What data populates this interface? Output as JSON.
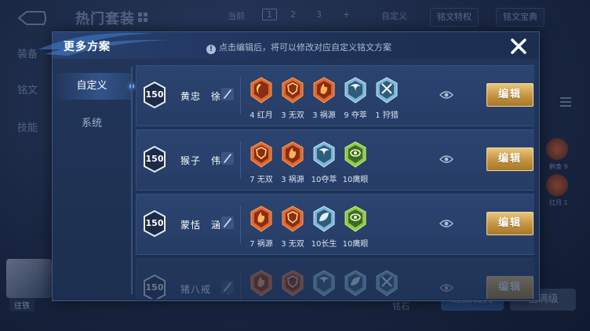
{
  "background": {
    "title": "热门套装",
    "pager": {
      "label": "当前",
      "pages": [
        "1",
        "2",
        "3"
      ],
      "add": "+"
    },
    "custom_label": "自定义",
    "buttons": {
      "rune_special": "铭文特权",
      "rune_guide": "铭文宝典"
    },
    "left_nav": [
      "装备",
      "铭文",
      "技能"
    ],
    "avatar_label": "往铁",
    "side_runes": [
      {
        "label": "鹤食 9"
      },
      {
        "label": "红月 1"
      }
    ],
    "bottom_left_text": "铭石",
    "bottom_buttons": {
      "first": "返回铭文",
      "second": "已满级"
    }
  },
  "modal": {
    "title": "更多方案",
    "info": "点击编辑后，将可以修改对应自定义铭文方案",
    "tabs": [
      {
        "label": "自定义",
        "active": true
      },
      {
        "label": "系统",
        "active": false
      }
    ],
    "edit_label": "编辑",
    "plans": [
      {
        "level": "150",
        "name": "黄忠　徐",
        "runes": [
          {
            "label": "4 红月",
            "kind": "red-moon"
          },
          {
            "label": "3 无双",
            "kind": "red-shield"
          },
          {
            "label": "3 祸源",
            "kind": "red-flame"
          },
          {
            "label": "9 夺萃",
            "kind": "blue-wing"
          },
          {
            "label": "1 狩猎",
            "kind": "blue-cross"
          }
        ]
      },
      {
        "level": "150",
        "name": "猴子　伟",
        "runes": [
          {
            "label": "7 无双",
            "kind": "red-shield"
          },
          {
            "label": "3 祸源",
            "kind": "red-flame"
          },
          {
            "label": "10夺萃",
            "kind": "blue-wing"
          },
          {
            "label": "10鹰眼",
            "kind": "green-eye"
          }
        ]
      },
      {
        "level": "150",
        "name": "蒙恬　涵",
        "runes": [
          {
            "label": "7 祸源",
            "kind": "red-flame"
          },
          {
            "label": "3 无双",
            "kind": "red-shield"
          },
          {
            "label": "10长生",
            "kind": "blue-leaf"
          },
          {
            "label": "10鹰眼",
            "kind": "green-eye"
          }
        ]
      },
      {
        "level": "150",
        "name": "猪八戒　兔",
        "runes": [
          {
            "label": "",
            "kind": "red-flame"
          },
          {
            "label": "",
            "kind": "red-shield"
          },
          {
            "label": "",
            "kind": "blue-wing"
          },
          {
            "label": "",
            "kind": "blue-leaf"
          },
          {
            "label": "",
            "kind": "blue-cross"
          }
        ]
      }
    ]
  },
  "colors": {
    "accent_gold": "#d4a554",
    "panel": "#22365a",
    "row": "#2b4470"
  }
}
